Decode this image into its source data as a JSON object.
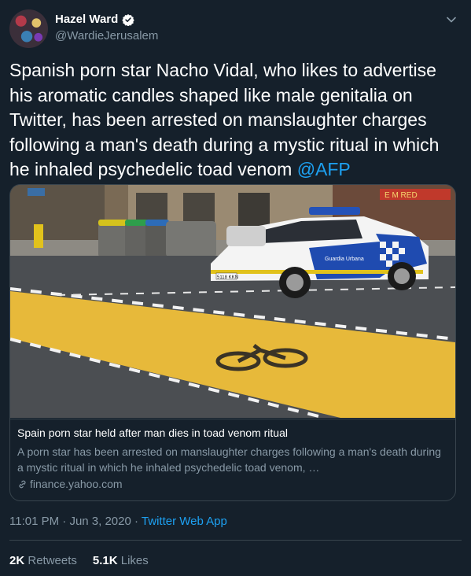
{
  "author": {
    "display_name": "Hazel Ward",
    "handle": "@WardieJerusalem"
  },
  "tweet": {
    "text": "Spanish porn star Nacho Vidal, who likes to advertise his aromatic candles shaped like male genitalia on Twitter, has been arrested on manslaughter charges following a man's death during a mystic ritual in which he inhaled psychedelic toad venom",
    "mention": "@AFP"
  },
  "card": {
    "title": "Spain porn star held after man dies in toad venom ritual",
    "description": "A porn star has been arrested on manslaughter charges following a man's death during a mystic ritual in which he inhaled psychedelic toad venom, …",
    "domain": "finance.yahoo.com",
    "image_text": {
      "car_text": "Guardia Urbana",
      "plate": "5118 KKN",
      "sign": "E  M  RED"
    }
  },
  "meta": {
    "time": "11:01 PM",
    "sep1": " · ",
    "date": "Jun 3, 2020",
    "sep2": " · ",
    "app": "Twitter Web App"
  },
  "stats": {
    "retweets_count": "2K",
    "retweets_label": "Retweets",
    "likes_count": "5.1K",
    "likes_label": "Likes"
  },
  "colors": {
    "background": "#15202b",
    "accent": "#1da1f2",
    "secondary_text": "#8899a6",
    "border": "#38444d"
  },
  "icons": [
    "verified-badge-icon",
    "chevron-down-icon",
    "link-icon"
  ]
}
